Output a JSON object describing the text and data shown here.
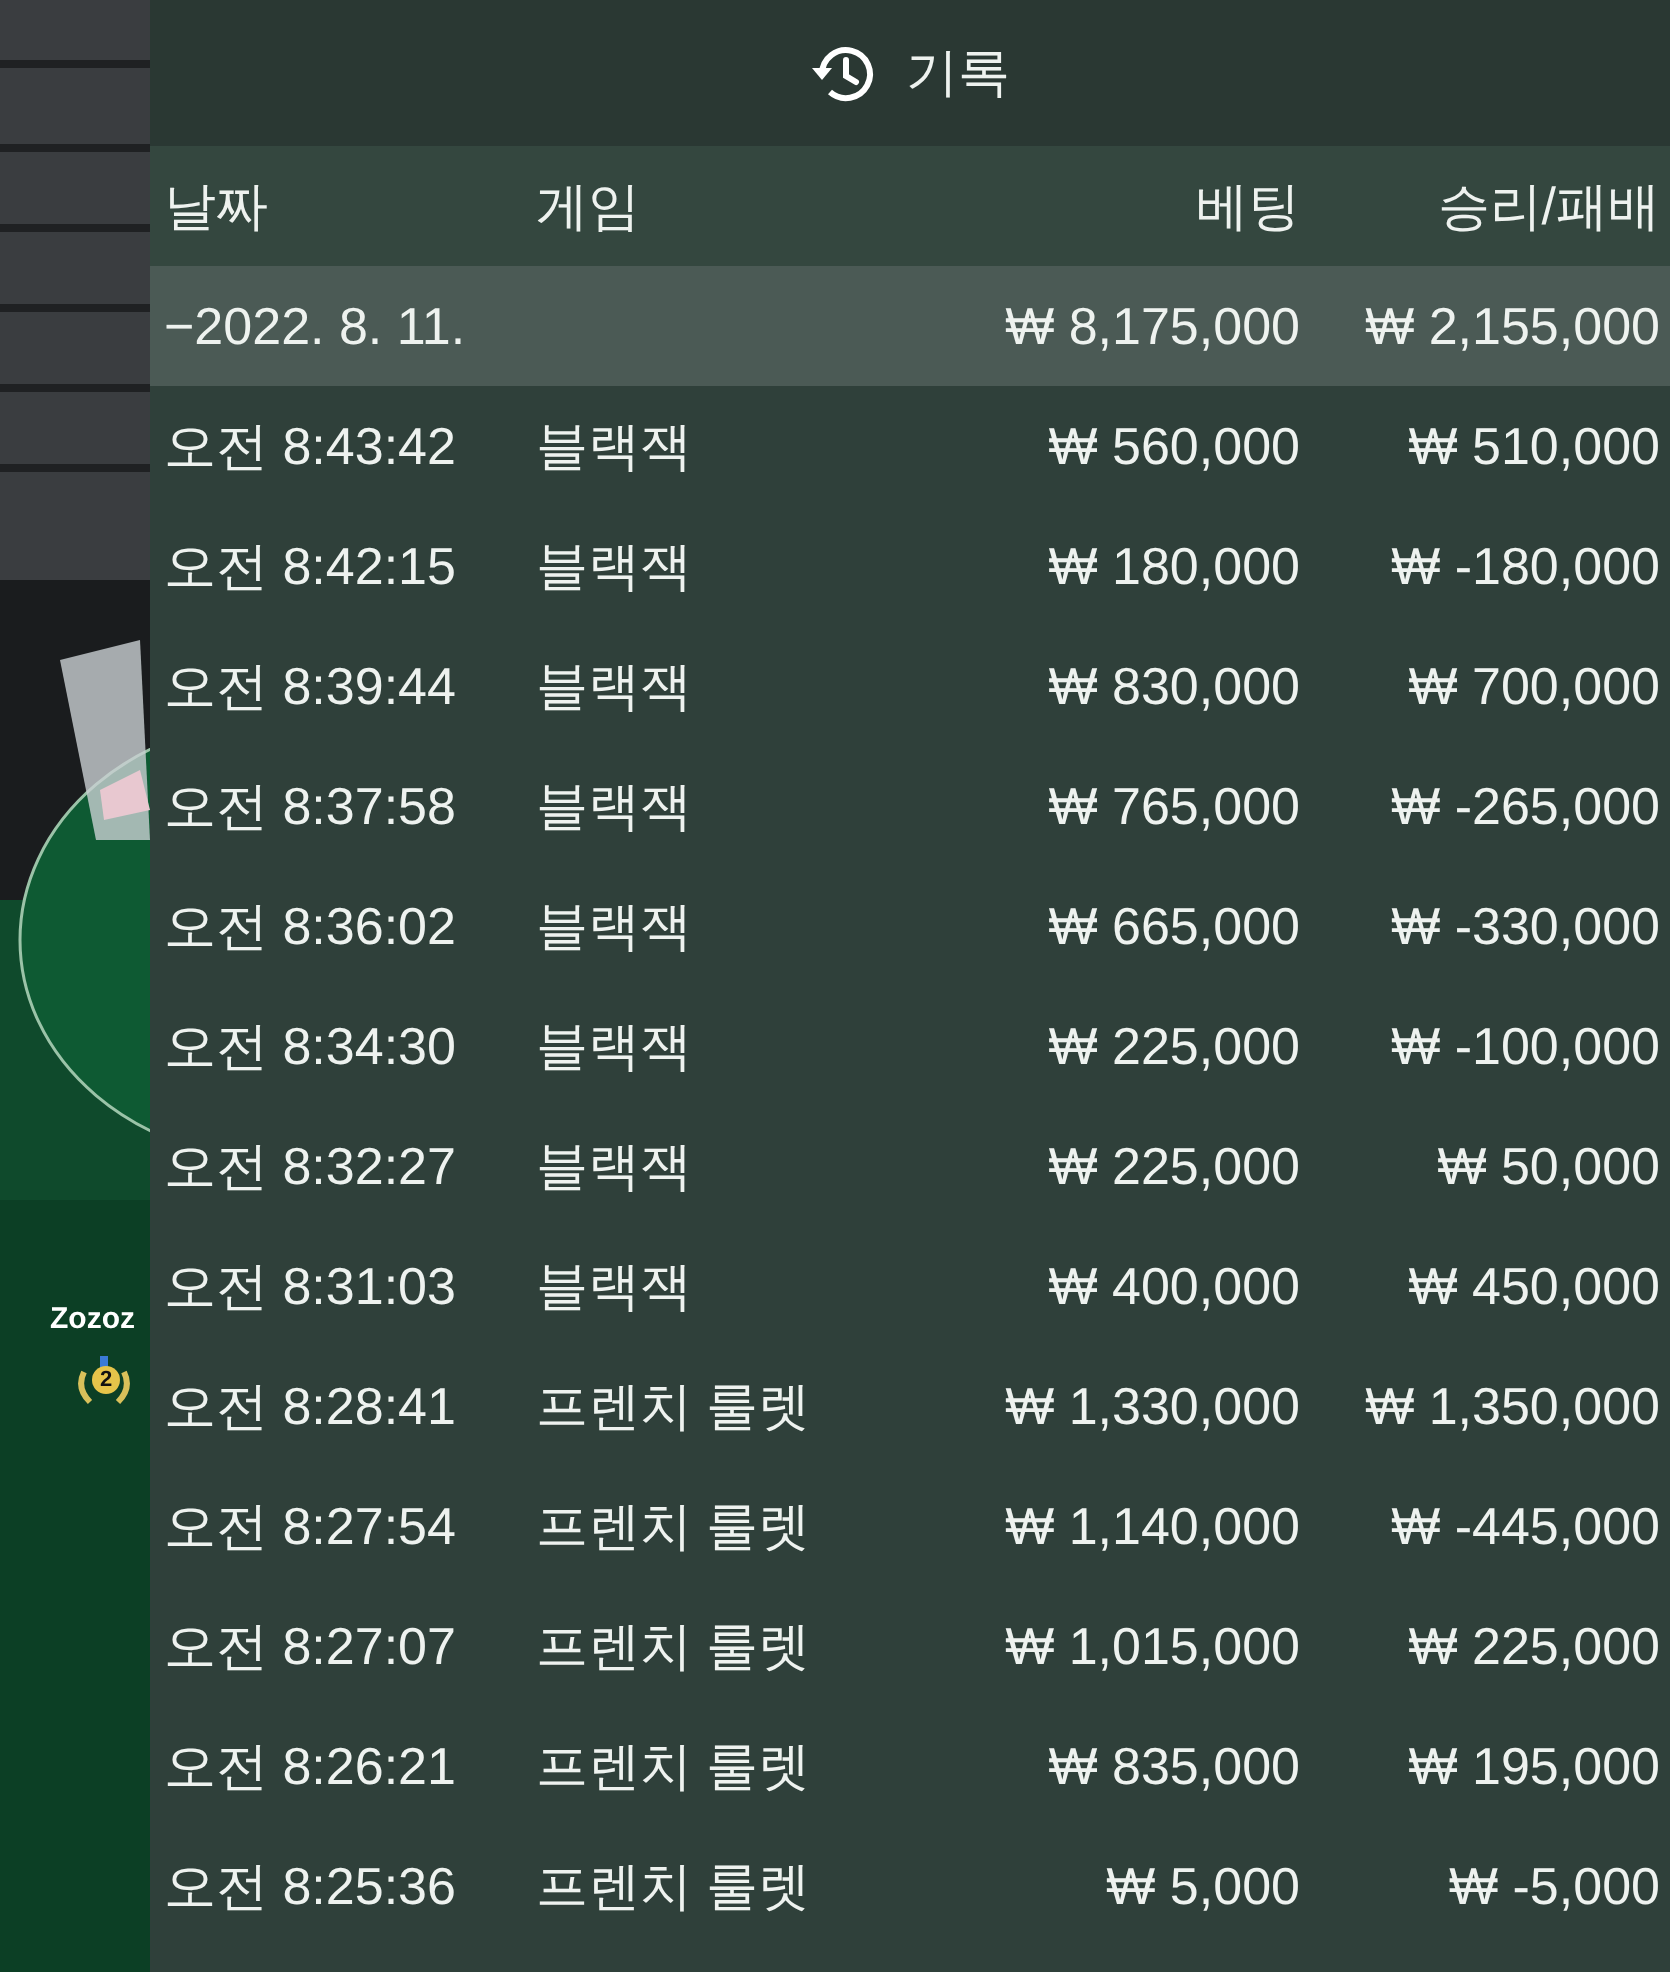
{
  "background": {
    "player": {
      "name": "Zozoz",
      "rank": "2"
    }
  },
  "panel": {
    "title": "기록",
    "columns": [
      "날짜",
      "게임",
      "베팅",
      "승리/패배"
    ],
    "groups": [
      {
        "date": "−2022. 8. 11.",
        "bet": "₩ 8,175,000",
        "result": "₩ 2,155,000",
        "rows": [
          {
            "time": "오전 8:43:42",
            "game": "블랙잭",
            "bet": "₩ 560,000",
            "result": "₩ 510,000"
          },
          {
            "time": "오전 8:42:15",
            "game": "블랙잭",
            "bet": "₩ 180,000",
            "result": "₩ -180,000"
          },
          {
            "time": "오전 8:39:44",
            "game": "블랙잭",
            "bet": "₩ 830,000",
            "result": "₩ 700,000"
          },
          {
            "time": "오전 8:37:58",
            "game": "블랙잭",
            "bet": "₩ 765,000",
            "result": "₩ -265,000"
          },
          {
            "time": "오전 8:36:02",
            "game": "블랙잭",
            "bet": "₩ 665,000",
            "result": "₩ -330,000"
          },
          {
            "time": "오전 8:34:30",
            "game": "블랙잭",
            "bet": "₩ 225,000",
            "result": "₩ -100,000"
          },
          {
            "time": "오전 8:32:27",
            "game": "블랙잭",
            "bet": "₩ 225,000",
            "result": "₩ 50,000"
          },
          {
            "time": "오전 8:31:03",
            "game": "블랙잭",
            "bet": "₩ 400,000",
            "result": "₩ 450,000"
          },
          {
            "time": "오전 8:28:41",
            "game": "프렌치 룰렛",
            "bet": "₩ 1,330,000",
            "result": "₩ 1,350,000"
          },
          {
            "time": "오전 8:27:54",
            "game": "프렌치 룰렛",
            "bet": "₩ 1,140,000",
            "result": "₩ -445,000"
          },
          {
            "time": "오전 8:27:07",
            "game": "프렌치 룰렛",
            "bet": "₩ 1,015,000",
            "result": "₩ 225,000"
          },
          {
            "time": "오전 8:26:21",
            "game": "프렌치 룰렛",
            "bet": "₩ 835,000",
            "result": "₩ 195,000"
          },
          {
            "time": "오전 8:25:36",
            "game": "프렌치 룰렛",
            "bet": "₩ 5,000",
            "result": "₩ -5,000"
          }
        ]
      }
    ]
  }
}
